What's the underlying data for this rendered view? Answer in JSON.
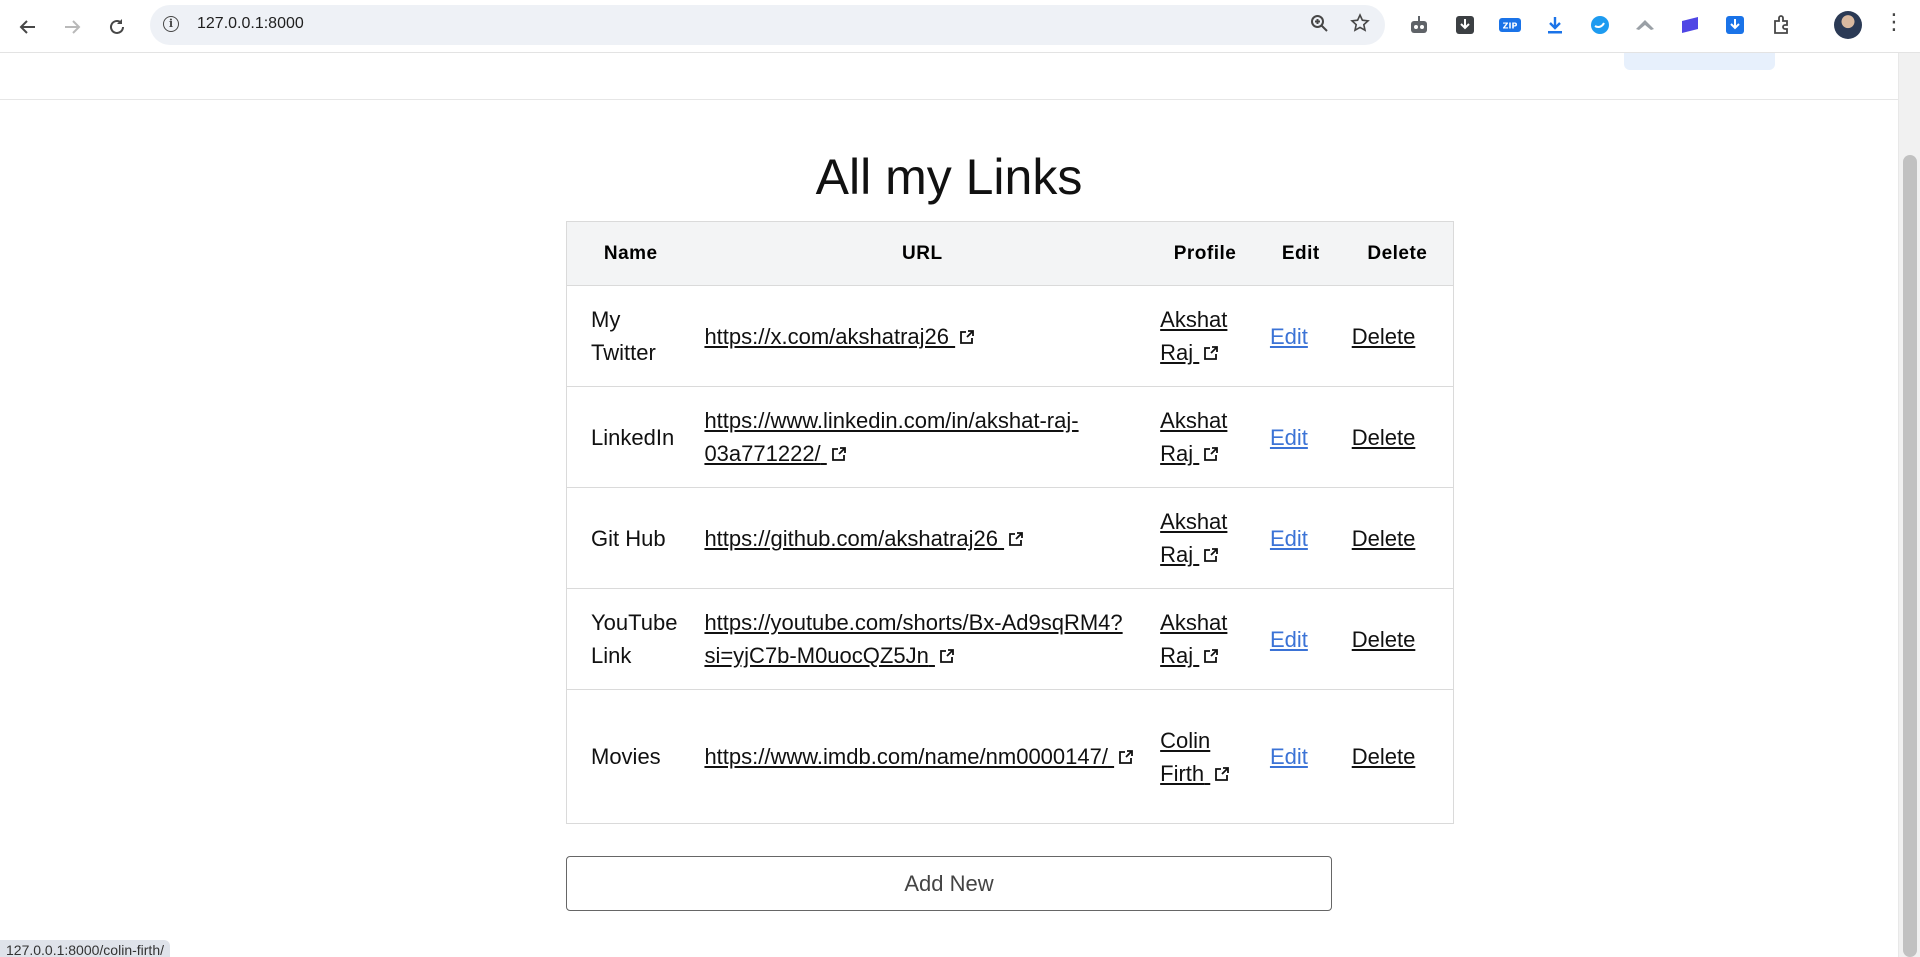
{
  "browser": {
    "url": "127.0.0.1:8000",
    "status_url": "127.0.0.1:8000/colin-firth/"
  },
  "page": {
    "title": "All my Links",
    "add_button": "Add New"
  },
  "table": {
    "headers": [
      "Name",
      "URL",
      "Profile",
      "Edit",
      "Delete"
    ],
    "rows": [
      {
        "name": "My Twitter",
        "url": "https://x.com/akshatraj26",
        "profile": "Akshat Raj",
        "edit": "Edit",
        "delete": "Delete"
      },
      {
        "name": "LinkedIn",
        "url": "https://www.linkedin.com/in/akshat-raj-03a771222/",
        "profile": "Akshat Raj",
        "edit": "Edit",
        "delete": "Delete"
      },
      {
        "name": "Git Hub",
        "url": "https://github.com/akshatraj26",
        "profile": "Akshat Raj",
        "edit": "Edit",
        "delete": "Delete"
      },
      {
        "name": "YouTube Link",
        "url": "https://youtube.com/shorts/Bx-Ad9sqRM4?si=yjC7b-M0uocQZ5Jn",
        "profile": "Akshat Raj",
        "edit": "Edit",
        "delete": "Delete"
      },
      {
        "name": "Movies",
        "url": "https://www.imdb.com/name/nm0000147/",
        "profile": "Colin Firth",
        "edit": "Edit",
        "delete": "Delete"
      }
    ]
  },
  "colors": {
    "edit_link": "#3b73d6",
    "header_bg": "#f3f4f5"
  }
}
